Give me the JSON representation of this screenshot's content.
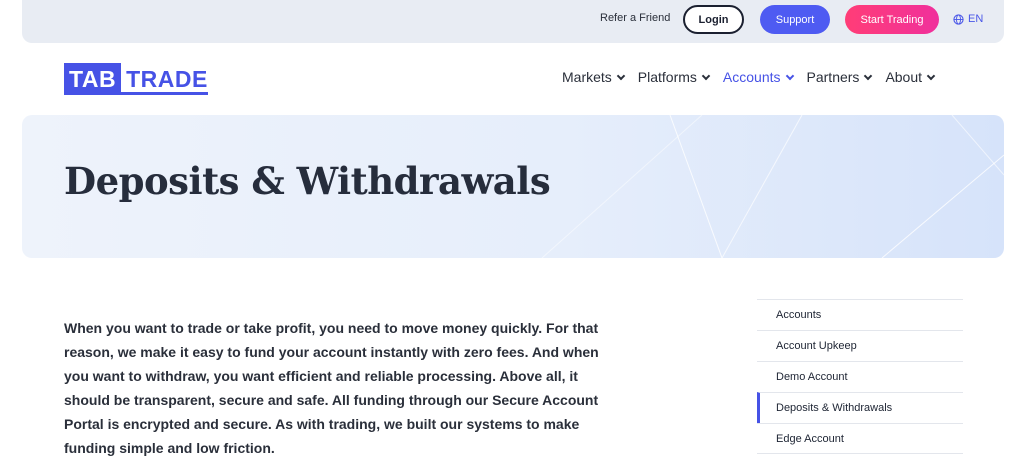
{
  "topbar": {
    "refer_label": "Refer a Friend",
    "login_label": "Login",
    "support_label": "Support",
    "start_label": "Start Trading",
    "lang_label": "EN"
  },
  "logo": {
    "part_a": "TAB",
    "part_b": "TRADE"
  },
  "nav": {
    "items": [
      {
        "label": "Markets"
      },
      {
        "label": "Platforms"
      },
      {
        "label": "Accounts",
        "active": true
      },
      {
        "label": "Partners"
      },
      {
        "label": "About"
      }
    ]
  },
  "hero": {
    "title": "Deposits & Withdrawals"
  },
  "intro": {
    "text": "When you want to trade or take profit, you need to move money quickly. For that reason, we make it easy to fund your account instantly with zero fees. And when you want to withdraw, you want efficient and reliable processing. Above all, it should be transparent, secure and safe. All funding through our Secure Account Portal is encrypted and secure. As with trading, we built our systems to make funding simple and low friction."
  },
  "sidebar": {
    "items": [
      {
        "label": "Accounts"
      },
      {
        "label": "Account Upkeep"
      },
      {
        "label": "Demo Account"
      },
      {
        "label": "Deposits & Withdrawals",
        "active": true
      },
      {
        "label": "Edge Account"
      }
    ]
  },
  "colors": {
    "accent": "#4652e6",
    "support_button": "#4e5bf2",
    "start_button": "#ff3d77",
    "hero_bg": "#e6eefb"
  },
  "icons": {
    "language": "globe-icon",
    "dropdown": "chevron-down-icon"
  }
}
